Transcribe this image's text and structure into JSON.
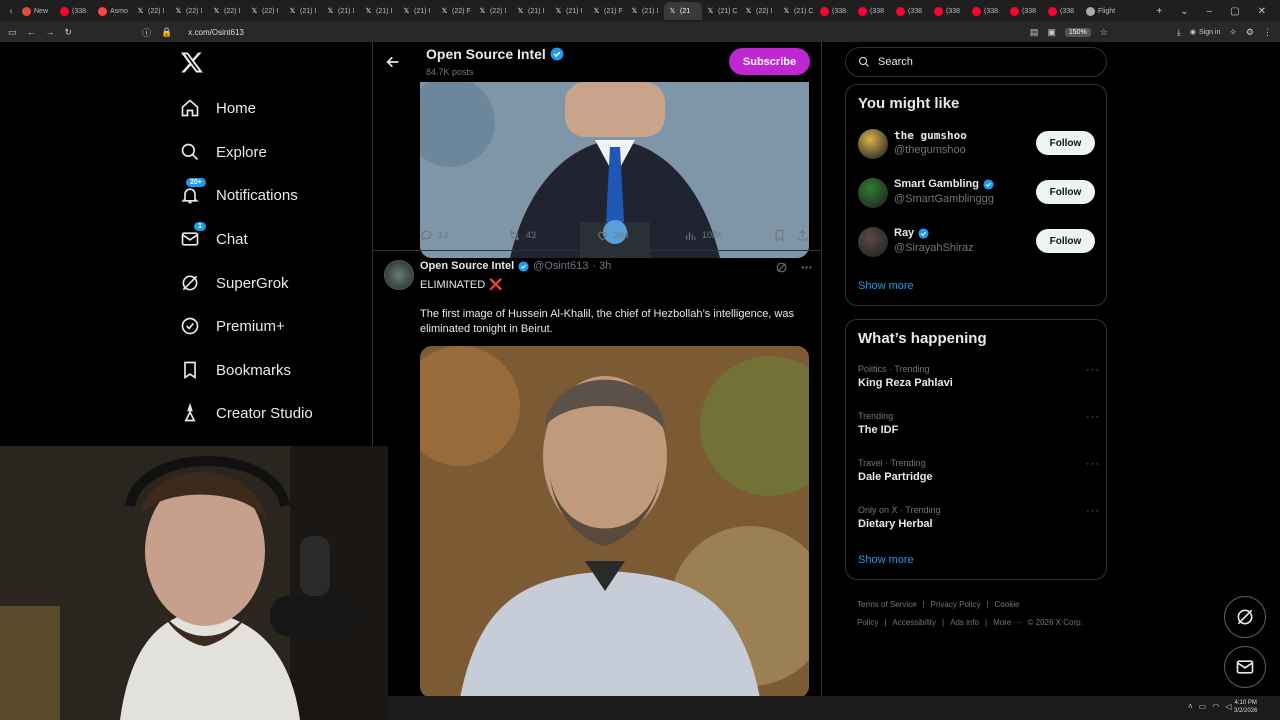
{
  "browser": {
    "tabs": [
      {
        "label": "New",
        "icon": "browser-icon",
        "color": "#e04d3a"
      },
      {
        "label": "(338",
        "icon": "youtube-icon",
        "color": "#ff0033"
      },
      {
        "label": "Asmo",
        "icon": "twitch-icon",
        "color": "#ff4444"
      },
      {
        "label": "(22) I",
        "icon": "x-icon",
        "color": "#ffffff"
      },
      {
        "label": "(22) I",
        "icon": "x-icon",
        "color": "#ffffff"
      },
      {
        "label": "(22) I",
        "icon": "x-icon",
        "color": "#ffffff"
      },
      {
        "label": "(22) I",
        "icon": "x-icon",
        "color": "#ffffff"
      },
      {
        "label": "(21) I",
        "icon": "x-icon",
        "color": "#ffffff"
      },
      {
        "label": "(21) I",
        "icon": "x-icon",
        "color": "#ffffff"
      },
      {
        "label": "(21) I",
        "icon": "x-icon",
        "color": "#ffffff"
      },
      {
        "label": "(21) I",
        "icon": "x-icon",
        "color": "#ffffff"
      },
      {
        "label": "(22) F",
        "icon": "x-icon",
        "color": "#ffffff"
      },
      {
        "label": "(22) I",
        "icon": "x-icon",
        "color": "#ffffff"
      },
      {
        "label": "(21) I",
        "icon": "x-icon",
        "color": "#ffffff"
      },
      {
        "label": "(21) I",
        "icon": "x-icon",
        "color": "#ffffff"
      },
      {
        "label": "(21) F",
        "icon": "x-icon",
        "color": "#ffffff"
      },
      {
        "label": "(21) I",
        "icon": "x-icon",
        "color": "#ffffff"
      },
      {
        "label": "(21",
        "icon": "x-icon",
        "color": "#ffffff",
        "active": true
      },
      {
        "label": "(21) C",
        "icon": "x-icon",
        "color": "#ffffff"
      },
      {
        "label": "(22) I",
        "icon": "x-icon",
        "color": "#ffffff"
      },
      {
        "label": "(21) C",
        "icon": "x-icon",
        "color": "#ffffff"
      },
      {
        "label": "(338",
        "icon": "youtube-icon",
        "color": "#ff0033"
      },
      {
        "label": "(338",
        "icon": "youtube-icon",
        "color": "#ff0033"
      },
      {
        "label": "(338",
        "icon": "youtube-icon",
        "color": "#ff0033"
      },
      {
        "label": "(338",
        "icon": "youtube-icon",
        "color": "#ff0033"
      },
      {
        "label": "(338",
        "icon": "youtube-icon",
        "color": "#ff0033"
      },
      {
        "label": "(338",
        "icon": "youtube-icon",
        "color": "#ff0033"
      },
      {
        "label": "(338",
        "icon": "youtube-icon",
        "color": "#ff0033"
      },
      {
        "label": "Flight",
        "icon": "globe-icon",
        "color": "#aaaaaa"
      }
    ],
    "url": "x.com/Osint613",
    "zoom": "150%",
    "signin_label": "Sign in"
  },
  "nav": {
    "items": [
      {
        "label": "Home",
        "icon": "home-icon"
      },
      {
        "label": "Explore",
        "icon": "search-icon"
      },
      {
        "label": "Notifications",
        "icon": "bell-icon",
        "badge": "20+"
      },
      {
        "label": "Chat",
        "icon": "mail-icon",
        "badge": "1"
      },
      {
        "label": "SuperGrok",
        "icon": "grok-icon"
      },
      {
        "label": "Premium+",
        "icon": "premium-icon"
      },
      {
        "label": "Bookmarks",
        "icon": "bookmark-icon"
      },
      {
        "label": "Creator Studio",
        "icon": "creator-studio-icon"
      }
    ]
  },
  "profile": {
    "name": "Open Source Intel",
    "posts": "84.7K posts",
    "subscribe_label": "Subscribe"
  },
  "tweet1": {
    "replies": "13",
    "reposts": "43",
    "likes": "364",
    "views": "108K"
  },
  "tweet2": {
    "name": "Open Source Intel",
    "handle": "@Osint613",
    "time": "· 3h",
    "title": "ELIMINATED",
    "title_emoji": "❌",
    "body": "The first image of Hussein Al-Khalil, the chief of Hezbollah’s intelligence, was eliminated tonight in Beirut."
  },
  "sidebar": {
    "search_placeholder": "Search",
    "wtf_title": "You might like",
    "wtf": [
      {
        "name": "the gumshoo",
        "handle": "@thegumshoo",
        "verified": false,
        "follow": "Follow",
        "color": "#d9b44a"
      },
      {
        "name": "Smart Gambling",
        "handle": "@SmartGamblinggg",
        "verified": true,
        "follow": "Follow",
        "color": "#2e7d32"
      },
      {
        "name": "Ray",
        "handle": "@SirayahShiraz",
        "verified": true,
        "follow": "Follow",
        "color": "#5a4a48"
      }
    ],
    "wtf_show_more": "Show more",
    "trends_title": "What’s happening",
    "trends": [
      {
        "meta": "Politics · Trending",
        "name": "King Reza Pahlavi"
      },
      {
        "meta": "Trending",
        "name": "The IDF"
      },
      {
        "meta": "Travel · Trending",
        "name": "Dale Partridge"
      },
      {
        "meta": "Only on X · Trending",
        "name": "Dietary Herbal"
      }
    ],
    "trends_show_more": "Show more",
    "footer": [
      "Terms of Service",
      "|",
      "Privacy Policy",
      "|",
      "Cookie Policy",
      "|",
      "Accessibility",
      "|",
      "Ads info",
      "|",
      "More ···",
      "© 2026 X Corp."
    ]
  },
  "taskbar": {
    "time": "4:10 PM",
    "date": "3/2/2026"
  },
  "colors": {
    "accent": "#1d9bf0",
    "subscribe": "#c026d3",
    "verified": "#1d9bf0"
  }
}
